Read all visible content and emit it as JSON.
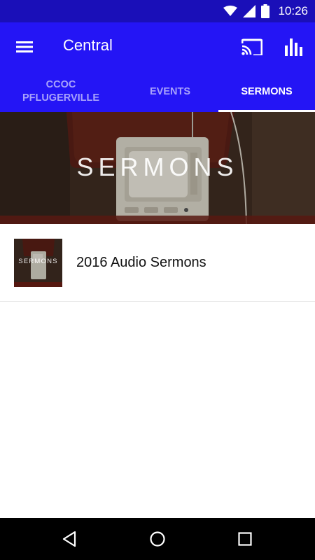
{
  "status_bar": {
    "time": "10:26",
    "icons": [
      "wifi-icon",
      "cell-signal-icon",
      "battery-icon"
    ]
  },
  "app_bar": {
    "title": "Central",
    "icons": [
      "menu-icon",
      "cast-icon",
      "bar-chart-icon"
    ]
  },
  "tabs": [
    {
      "label": "CCOC PFLUGERVILLE",
      "active": false
    },
    {
      "label": "EVENTS",
      "active": false
    },
    {
      "label": "SERMONS",
      "active": true
    }
  ],
  "hero": {
    "title": "SERMONS"
  },
  "list": {
    "items": [
      {
        "title": "2016 Audio Sermons",
        "thumbnail_text": "SERMONS"
      }
    ]
  },
  "nav_bar": {
    "icons": [
      "back-icon",
      "home-icon",
      "recents-icon"
    ]
  },
  "colors": {
    "status_bar": "#1a0fb8",
    "app_bar": "#2415f5",
    "nav_bar": "#000000"
  }
}
